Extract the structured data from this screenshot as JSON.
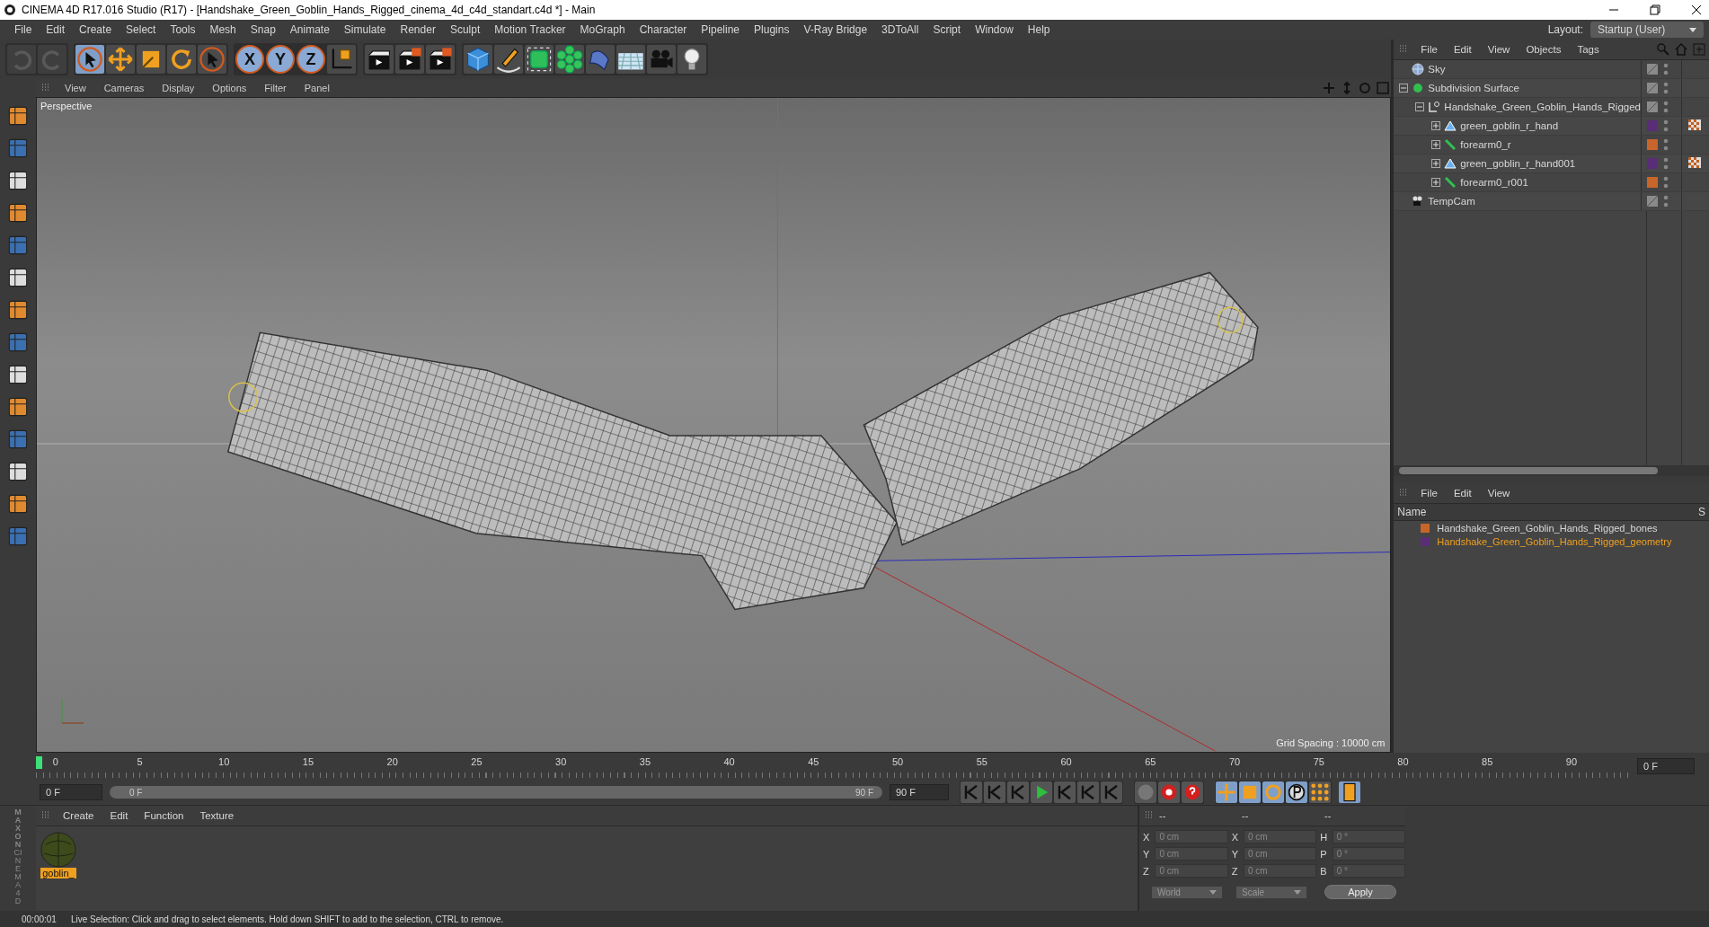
{
  "window": {
    "title": "CINEMA 4D R17.016 Studio (R17) - [Handshake_Green_Goblin_Hands_Rigged_cinema_4d_c4d_standart.c4d *] - Main"
  },
  "menu": [
    "File",
    "Edit",
    "Create",
    "Select",
    "Tools",
    "Mesh",
    "Snap",
    "Animate",
    "Simulate",
    "Render",
    "Sculpt",
    "Motion Tracker",
    "MoGraph",
    "Character",
    "Pipeline",
    "Plugins",
    "V-Ray Bridge",
    "3DToAll",
    "Script",
    "Window",
    "Help"
  ],
  "layout": {
    "label": "Layout:",
    "value": "Startup (User)"
  },
  "axis_buttons": [
    "X",
    "Y",
    "Z"
  ],
  "viewport": {
    "menu": [
      "View",
      "Cameras",
      "Display",
      "Options",
      "Filter",
      "Panel"
    ],
    "camera": "Perspective",
    "grid_spacing": "Grid Spacing : 10000 cm"
  },
  "object_manager": {
    "menu": [
      "File",
      "Edit",
      "View",
      "Objects",
      "Tags"
    ],
    "objects": [
      {
        "name": "Sky",
        "kind": "sky",
        "selected": false
      },
      {
        "name": "Subdivision Surface",
        "kind": "subdivision",
        "expanded": true,
        "selected": false,
        "children": [
          {
            "name": "Handshake_Green_Goblin_Hands_Rigged",
            "kind": "null",
            "expanded": true,
            "selected": false,
            "children": [
              {
                "name": "green_goblin_r_hand",
                "kind": "polygon",
                "expanded": false,
                "color": "#5a2d78",
                "tag": true,
                "selected": false
              },
              {
                "name": "forearm0_r",
                "kind": "bone",
                "expanded": false,
                "color": "#c8652a",
                "tag": false,
                "selected": false
              },
              {
                "name": "green_goblin_r_hand001",
                "kind": "polygon",
                "expanded": false,
                "color": "#5a2d78",
                "tag": true,
                "selected": false
              },
              {
                "name": "forearm0_r001",
                "kind": "bone",
                "expanded": false,
                "color": "#c8652a",
                "tag": false,
                "selected": false
              }
            ]
          }
        ]
      },
      {
        "name": "TempCam",
        "kind": "camera",
        "selected": false
      }
    ]
  },
  "layer_manager": {
    "menu": [
      "File",
      "Edit",
      "View"
    ],
    "column": "Name",
    "column_2": "S",
    "layers": [
      {
        "name": "Handshake_Green_Goblin_Hands_Rigged_bones",
        "color": "#c8652a",
        "selected": false
      },
      {
        "name": "Handshake_Green_Goblin_Hands_Rigged_geometry",
        "color": "#5a2d78",
        "selected": true
      }
    ]
  },
  "timeline": {
    "ticks": [
      "0",
      "5",
      "10",
      "15",
      "20",
      "25",
      "30",
      "35",
      "40",
      "45",
      "50",
      "55",
      "60",
      "65",
      "70",
      "75",
      "80",
      "85",
      "90"
    ],
    "playhead": {
      "level": 0
    },
    "range": {
      "level": 1
    },
    "current": "0 F",
    "start": "0 F",
    "range_start": "0 F",
    "range_end": "90 F",
    "end": "90 F"
  },
  "material_manager": {
    "menu": [
      "Create",
      "Edit",
      "Function",
      "Texture"
    ],
    "materials": [
      {
        "name": "goblin_",
        "selected": true
      }
    ]
  },
  "coordinates": {
    "headers": [
      "--",
      "--",
      "--"
    ],
    "rows": [
      {
        "a": "X",
        "a_value": "0 cm",
        "b": "X",
        "b_value": "0 cm",
        "c": "H",
        "c_value": "0 °"
      },
      {
        "a": "Y",
        "a_value": "0 cm",
        "b": "Y",
        "b_value": "0 cm",
        "c": "P",
        "c_value": "0 °"
      },
      {
        "a": "Z",
        "a_value": "0 cm",
        "b": "Z",
        "b_value": "0 cm",
        "c": "B",
        "c_value": "0 °"
      }
    ],
    "mode": "World",
    "transform": "Scale",
    "apply": "Apply"
  },
  "brand": [
    "MAXON",
    "CINEMA 4D"
  ],
  "status_bar": {
    "time": "00:00:01",
    "message": "Live Selection: Click and drag to select elements. Hold down SHIFT to add to the selection, CTRL to remove."
  }
}
